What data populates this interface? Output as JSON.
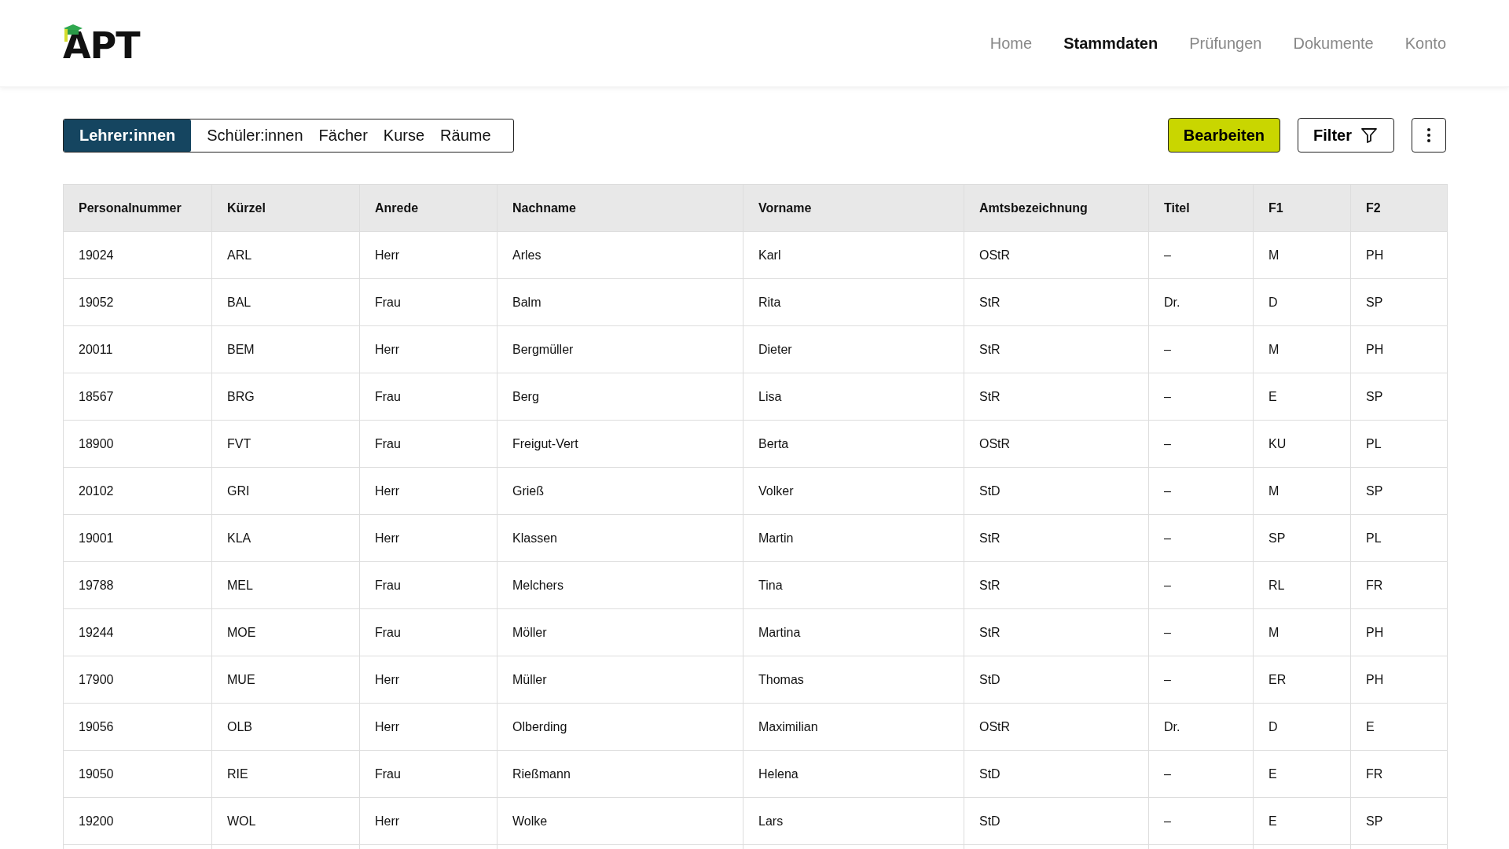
{
  "logo": {
    "text": "APT"
  },
  "nav": [
    {
      "label": "Home",
      "selected": false
    },
    {
      "label": "Stammdaten",
      "selected": true
    },
    {
      "label": "Prüfungen",
      "selected": false
    },
    {
      "label": "Dokumente",
      "selected": false
    },
    {
      "label": "Konto",
      "selected": false
    }
  ],
  "tabs": [
    {
      "label": "Lehrer:innen",
      "selected": true
    },
    {
      "label": "Schüler:innen",
      "selected": false
    },
    {
      "label": "Fächer",
      "selected": false
    },
    {
      "label": "Kurse",
      "selected": false
    },
    {
      "label": "Räume",
      "selected": false
    }
  ],
  "actions": {
    "edit": "Bearbeiten",
    "filter": "Filter"
  },
  "table": {
    "columns": [
      "Personalnummer",
      "Kürzel",
      "Anrede",
      "Nachname",
      "Vorname",
      "Amtsbezeichnung",
      "Titel",
      "F1",
      "F2"
    ],
    "rows": [
      [
        "19024",
        "ARL",
        "Herr",
        "Arles",
        "Karl",
        "OStR",
        "–",
        "M",
        "PH"
      ],
      [
        "19052",
        "BAL",
        "Frau",
        "Balm",
        "Rita",
        "StR",
        "Dr.",
        "D",
        "SP"
      ],
      [
        "20011",
        "BEM",
        "Herr",
        "Bergmüller",
        "Dieter",
        "StR",
        "–",
        "M",
        "PH"
      ],
      [
        "18567",
        "BRG",
        "Frau",
        "Berg",
        "Lisa",
        "StR",
        "–",
        "E",
        "SP"
      ],
      [
        "18900",
        "FVT",
        "Frau",
        "Freigut-Vert",
        "Berta",
        "OStR",
        "–",
        "KU",
        "PL"
      ],
      [
        "20102",
        "GRI",
        "Herr",
        "Grieß",
        "Volker",
        "StD",
        "–",
        "M",
        "SP"
      ],
      [
        "19001",
        "KLA",
        "Herr",
        "Klassen",
        "Martin",
        "StR",
        "–",
        "SP",
        "PL"
      ],
      [
        "19788",
        "MEL",
        "Frau",
        "Melchers",
        "Tina",
        "StR",
        "–",
        "RL",
        "FR"
      ],
      [
        "19244",
        "MOE",
        "Frau",
        "Möller",
        "Martina",
        "StR",
        "–",
        "M",
        "PH"
      ],
      [
        "17900",
        "MUE",
        "Herr",
        "Müller",
        "Thomas",
        "StD",
        "–",
        "ER",
        "PH"
      ],
      [
        "19056",
        "OLB",
        "Herr",
        "Olberding",
        "Maximilian",
        "OStR",
        "Dr.",
        "D",
        "E"
      ],
      [
        "19050",
        "RIE",
        "Frau",
        "Rießmann",
        "Helena",
        "StD",
        "–",
        "E",
        "FR"
      ],
      [
        "19200",
        "WOL",
        "Herr",
        "Wolke",
        "Lars",
        "StD",
        "–",
        "E",
        "SP"
      ]
    ]
  }
}
